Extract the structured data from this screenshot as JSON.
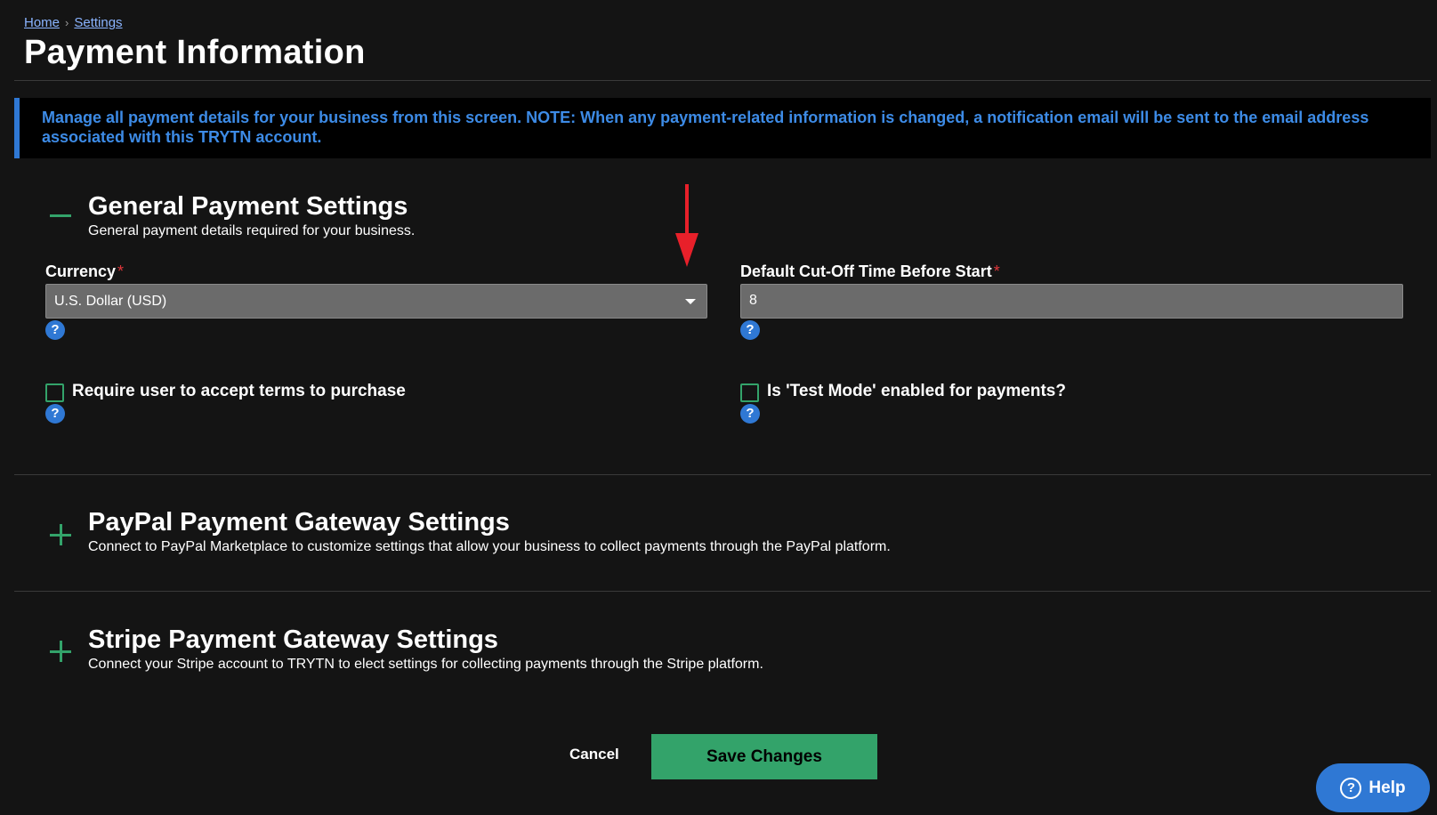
{
  "breadcrumb": {
    "home": "Home",
    "separator": "›",
    "settings": "Settings"
  },
  "page_title": "Payment Information",
  "notice": "Manage all payment details for your business from this screen. NOTE: When any payment-related information is changed, a notification email will be sent to the email address associated with this TRYTN account.",
  "general": {
    "title": "General Payment Settings",
    "description": "General payment details required for your business.",
    "currency_label": "Currency",
    "currency_value": "U.S. Dollar (USD)",
    "cutoff_label": "Default Cut-Off Time Before Start",
    "cutoff_value": "8",
    "required_mark": "*",
    "terms_label": "Require user to accept terms to purchase",
    "test_mode_label": "Is 'Test Mode' enabled for payments?",
    "help_glyph": "?"
  },
  "paypal": {
    "title": "PayPal Payment Gateway Settings",
    "description": "Connect to PayPal Marketplace to customize settings that allow your business to collect payments through the PayPal platform."
  },
  "stripe": {
    "title": "Stripe Payment Gateway Settings",
    "description": "Connect your Stripe account to TRYTN to elect settings for collecting payments through the Stripe platform."
  },
  "actions": {
    "cancel": "Cancel",
    "save": "Save Changes"
  },
  "help_button": {
    "label": "Help",
    "glyph": "?"
  },
  "colors": {
    "accent_green": "#33a36a",
    "accent_blue": "#2f78d4",
    "required_red": "#e0363b",
    "annotation_arrow": "#e8202a"
  },
  "icons": {
    "expanded": "minus-icon",
    "collapsed": "plus-icon",
    "dropdown": "chevron-down-icon",
    "help": "question-circle-icon"
  }
}
